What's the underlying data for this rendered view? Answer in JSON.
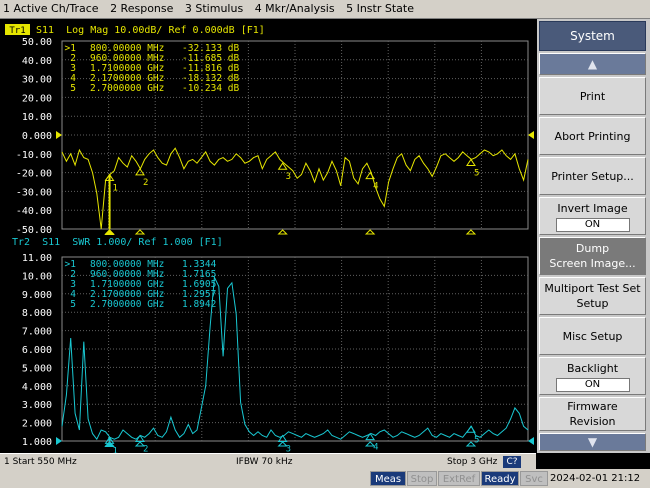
{
  "menu": [
    "1 Active Ch/Trace",
    "2 Response",
    "3 Stimulus",
    "4 Mkr/Analysis",
    "5 Instr State"
  ],
  "colors": {
    "trace1": "#e6e600",
    "trace2": "#19c8d2",
    "grid": "#606060",
    "axis_text": "#ffffff"
  },
  "trace1": {
    "tag": "Tr1",
    "header": " S11  Log Mag 10.00dB/ Ref 0.000dB [F1]",
    "yticks": [
      "50.00",
      "40.00",
      "30.00",
      "20.00",
      "10.00",
      "0.000",
      "-10.00",
      "-20.00",
      "-30.00",
      "-40.00",
      "-50.00"
    ],
    "markers": [
      {
        "id": ">1",
        "freq": "800.00000 MHz",
        "val": "-32.133 dB"
      },
      {
        "id": "2",
        "freq": "960.00000 MHz",
        "val": "-11.685 dB"
      },
      {
        "id": "3",
        "freq": "1.7100000 GHz",
        "val": "-11.816 dB"
      },
      {
        "id": "4",
        "freq": "2.1700000 GHz",
        "val": "-18.132 dB"
      },
      {
        "id": "5",
        "freq": "2.7000000 GHz",
        "val": "-10.234 dB"
      }
    ],
    "ref_value": 0,
    "scale_per_div": 10,
    "data_db": [
      -9,
      -14,
      -10,
      -16,
      -8,
      -12,
      -13,
      -20,
      -31,
      -52,
      -24,
      -21,
      -19,
      -12,
      -15,
      -17,
      -11,
      -14,
      -18,
      -13,
      -10,
      -8,
      -12,
      -15,
      -16,
      -10,
      -7,
      -12,
      -18,
      -14,
      -13,
      -15,
      -12,
      -9,
      -14,
      -16,
      -13,
      -12,
      -14,
      -13,
      -10,
      -12,
      -15,
      -14,
      -12,
      -11,
      -18,
      -13,
      -11,
      -9,
      -13,
      -15,
      -17,
      -19,
      -23,
      -21,
      -15,
      -19,
      -25,
      -18,
      -24,
      -20,
      -14,
      -19,
      -27,
      -12,
      -14,
      -23,
      -26,
      -18,
      -15,
      -20,
      -28,
      -34,
      -38,
      -25,
      -18,
      -12,
      -10,
      -16,
      -19,
      -13,
      -11,
      -15,
      -18,
      -22,
      -17,
      -11,
      -10,
      -12,
      -14,
      -12,
      -9,
      -11,
      -13,
      -12,
      -10,
      -8,
      -9,
      -11,
      -10,
      -8,
      -11,
      -13,
      -10,
      -18,
      -24,
      -13
    ]
  },
  "trace2": {
    "tag": "Tr2",
    "header": "Tr2  S11  SWR 1.000/ Ref 1.000 [F1]",
    "yticks": [
      "11.00",
      "10.00",
      "9.000",
      "8.000",
      "7.000",
      "6.000",
      "5.000",
      "4.000",
      "3.000",
      "2.000",
      "1.000"
    ],
    "markers": [
      {
        "id": ">1",
        "freq": "800.00000 MHz",
        "val": "1.3344"
      },
      {
        "id": "2",
        "freq": "960.00000 MHz",
        "val": "1.7165"
      },
      {
        "id": "3",
        "freq": "1.7100000 GHz",
        "val": "1.6905"
      },
      {
        "id": "4",
        "freq": "2.1700000 GHz",
        "val": "1.2957"
      },
      {
        "id": "5",
        "freq": "2.7000000 GHz",
        "val": "1.8942"
      }
    ],
    "ref_value": 1,
    "scale_per_div": 1,
    "data_swr": [
      1.8,
      3.5,
      6.6,
      2.5,
      1.6,
      6.4,
      2.2,
      1.4,
      1.1,
      1.6,
      1.5,
      1.2,
      1.1,
      1.2,
      1.6,
      1.4,
      1.2,
      1.1,
      1.3,
      1.2,
      1.4,
      1.7,
      1.3,
      1.2,
      1.5,
      2.3,
      1.6,
      1.2,
      1.4,
      1.9,
      1.4,
      1.6,
      2.8,
      4.0,
      7.2,
      9.9,
      9.4,
      5.6,
      9.3,
      9.6,
      7.9,
      3.1,
      1.9,
      1.5,
      1.3,
      1.5,
      1.3,
      1.2,
      1.6,
      1.3,
      1.2,
      1.3,
      1.5,
      1.4,
      1.3,
      1.2,
      1.4,
      1.3,
      1.2,
      1.3,
      1.4,
      1.6,
      1.3,
      1.2,
      1.1,
      1.3,
      1.5,
      1.4,
      1.3,
      1.2,
      1.3,
      1.4,
      1.3,
      1.5,
      1.6,
      1.4,
      1.2,
      1.3,
      1.5,
      1.4,
      1.3,
      1.2,
      1.3,
      1.5,
      1.7,
      1.3,
      1.2,
      1.4,
      1.3,
      1.2,
      1.4,
      1.3,
      1.2,
      1.5,
      1.8,
      1.3,
      1.2,
      1.4,
      1.6,
      1.4,
      1.3,
      1.5,
      1.7,
      2.2,
      2.8,
      2.5,
      1.8,
      1.6
    ]
  },
  "marker_positions_mhz": [
    800,
    960,
    1710,
    2170,
    2700
  ],
  "sweep": {
    "start_mhz": 550,
    "stop_mhz": 3000
  },
  "status": {
    "start": "1  Start 550 MHz",
    "ifbw": "IFBW 70 kHz",
    "stop": "Stop 3 GHz",
    "channel": "C?"
  },
  "indicators": [
    {
      "label": "Meas",
      "on": true
    },
    {
      "label": "Stop",
      "on": false
    },
    {
      "label": "ExtRef",
      "on": false
    },
    {
      "label": "Ready",
      "on": true
    },
    {
      "label": "Svc",
      "on": false
    }
  ],
  "datetime": "2024-02-01 21:12",
  "softkeys": {
    "title": "System",
    "print": "Print",
    "abort": "Abort Printing",
    "printer_setup": "Printer Setup...",
    "invert_label": "Invert Image",
    "invert_value": "ON",
    "dump_l1": "Dump",
    "dump_l2": "Screen Image...",
    "multiport_l1": "Multiport Test Set",
    "multiport_l2": "Setup",
    "misc": "Misc Setup",
    "backlight_label": "Backlight",
    "backlight_value": "ON",
    "firmware_l1": "Firmware",
    "firmware_l2": "Revision",
    "up_arrow": "▲",
    "down_arrow": "▼"
  }
}
